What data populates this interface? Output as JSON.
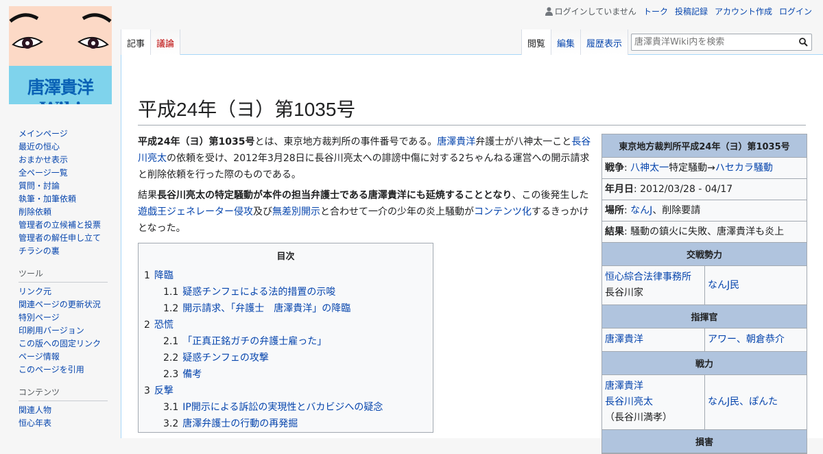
{
  "site": {
    "logo_text": "唐澤貴洋Wiki"
  },
  "personal_tools": {
    "anon": "ログインしていません",
    "links": [
      "トーク",
      "投稿記録",
      "アカウント作成",
      "ログイン"
    ]
  },
  "tabs": {
    "left": [
      {
        "label": "記事",
        "state": "selected"
      },
      {
        "label": "議論",
        "state": "new"
      }
    ],
    "right": [
      {
        "label": "閲覧",
        "state": "selected"
      },
      {
        "label": "編集",
        "state": "link"
      },
      {
        "label": "履歴表示",
        "state": "link"
      }
    ]
  },
  "search": {
    "placeholder": "唐澤貴洋Wiki内を検索"
  },
  "sidebar": {
    "nav": [
      "メインページ",
      "最近の恒心",
      "おまかせ表示",
      "全ページ一覧",
      "質問・討論",
      "執筆・加筆依頼",
      "削除依頼",
      "管理者の立候補と投票",
      "管理者の解任申し立て",
      "チラシの裏"
    ],
    "tools_heading": "ツール",
    "tools": [
      "リンク元",
      "関連ページの更新状況",
      "特別ページ",
      "印刷用バージョン",
      "この版への固定リンク",
      "ページ情報",
      "このページを引用"
    ],
    "contents_heading": "コンテンツ",
    "contents": [
      "関連人物",
      "恒心年表"
    ]
  },
  "article": {
    "title": "平成24年（ヨ）第1035号",
    "p1": {
      "bold": "平成24年（ヨ）第1035号",
      "t1": "とは、東京地方裁判所の事件番号である。",
      "l1": "唐澤貴洋",
      "t2": "弁護士が八神太一こと",
      "l2": "長谷川亮太",
      "t3": "の依頼を受け、2012年3月28日に長谷川亮太への誹謗中傷に対する2ちゃんねる運営への開示請求と削除依頼を行った際のものである。"
    },
    "p2": {
      "t1": "結果",
      "bold": "長谷川亮太の特定騒動が本件の担当弁護士である唐澤貴洋にも延焼することとなり",
      "t2": "、この後発生した",
      "l1": "遊戯王ジェネレーター侵攻",
      "t3": "及び",
      "l2": "無差別開示",
      "t4": "と合わせて一介の少年の炎上騒動が",
      "l3": "コンテンツ化",
      "t5": "するきっかけとなった。"
    }
  },
  "toc": {
    "title": "目次",
    "items": [
      {
        "num": "1",
        "label": "降臨",
        "level": 1
      },
      {
        "num": "1.1",
        "label": "疑惑チンフェによる法的措置の示唆",
        "level": 2
      },
      {
        "num": "1.2",
        "label": "開示請求、「弁護士　唐澤貴洋」の降臨",
        "level": 2
      },
      {
        "num": "2",
        "label": "恐慌",
        "level": 1
      },
      {
        "num": "2.1",
        "label": "「正真正銘ガチの弁護士雇った」",
        "level": 2
      },
      {
        "num": "2.2",
        "label": "疑惑チンフェの攻撃",
        "level": 2
      },
      {
        "num": "2.3",
        "label": "備考",
        "level": 2
      },
      {
        "num": "3",
        "label": "反撃",
        "level": 1
      },
      {
        "num": "3.1",
        "label": "IP開示による訴訟の実現性とバカビジへの疑念",
        "level": 2
      },
      {
        "num": "3.2",
        "label": "唐澤弁護士の行動の再発掘",
        "level": 2
      }
    ]
  },
  "infobox": {
    "title": "東京地方裁判所平成24年（ヨ）第1035号",
    "war": {
      "key": "戦争",
      "link": "八神太一",
      "text": "特定騒動→",
      "link2": "ハセカラ騒動"
    },
    "date": {
      "key": "年月日",
      "value": "2012/03/28 - 04/17"
    },
    "place": {
      "key": "場所",
      "link": "なんJ",
      "value": "、削除要請"
    },
    "result": {
      "key": "結果",
      "value": "騒動の鎮火に失敗、唐澤貴洋も炎上"
    },
    "belligerents_heading": "交戦勢力",
    "belligerents": {
      "left_link": "恒心綜合法律事務所",
      "left_text": "長谷川家",
      "right_link": "なんJ民"
    },
    "commanders_heading": "指揮官",
    "commanders": {
      "left_link": "唐澤貴洋",
      "right_link": "アワー、朝倉恭介"
    },
    "strength_heading": "戦力",
    "strength": {
      "left_link1": "唐澤貴洋",
      "left_link2": "長谷川亮太",
      "left_paren": "（長谷川満孝）",
      "right_link": "なんJ民、ぽんた"
    },
    "casualties_heading": "損害"
  }
}
